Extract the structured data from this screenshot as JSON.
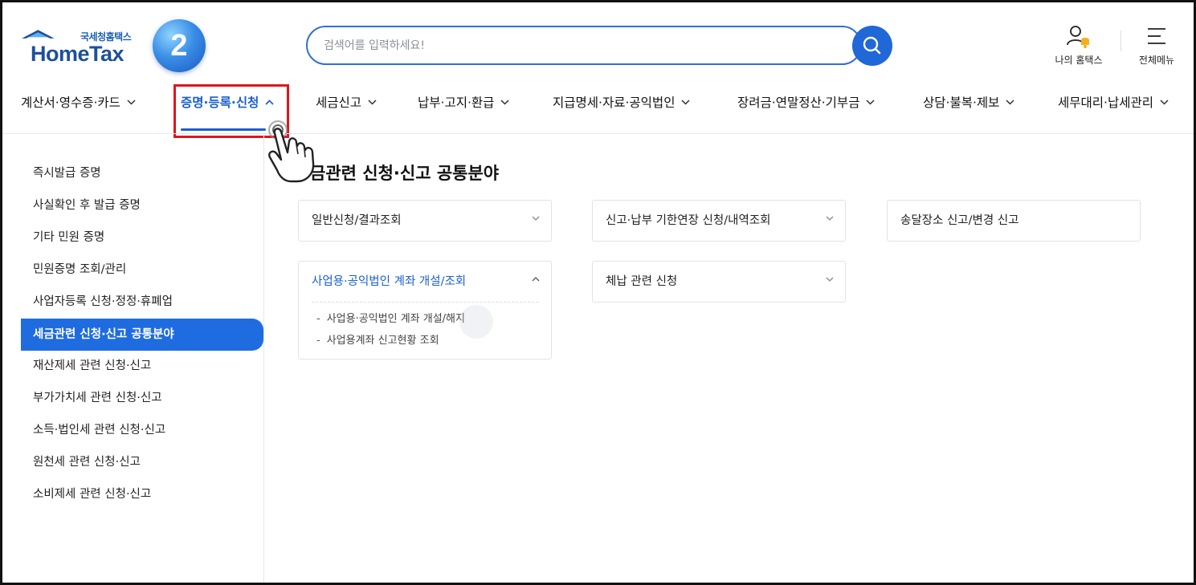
{
  "brand": {
    "logo_sub": "국세청홈택스",
    "logo_main": "HomeTax",
    "step_badge": "2"
  },
  "search": {
    "placeholder": "검색어를 입력하세요!"
  },
  "utilities": {
    "my_hometax": "나의 홈택스",
    "full_menu": "전체메뉴"
  },
  "nav": {
    "items": [
      {
        "label": "계산서·영수증·카드"
      },
      {
        "label": "증명·등록·신청"
      },
      {
        "label": "세금신고"
      },
      {
        "label": "납부·고지·환급"
      },
      {
        "label": "지급명세·자료·공익법인"
      },
      {
        "label": "장려금·연말정산·기부금"
      },
      {
        "label": "상담·불복·제보"
      },
      {
        "label": "세무대리·납세관리"
      }
    ]
  },
  "sidebar": {
    "items": [
      {
        "label": "즉시발급 증명"
      },
      {
        "label": "사실확인 후 발급 증명"
      },
      {
        "label": "기타 민원 증명"
      },
      {
        "label": "민원증명 조회/관리"
      },
      {
        "label": "사업자등록 신청·정정·휴폐업"
      },
      {
        "label": "세금관련 신청·신고 공통분야"
      },
      {
        "label": "재산제세 관련 신청·신고"
      },
      {
        "label": "부가가치세 관련 신청·신고"
      },
      {
        "label": "소득·법인세 관련 신청·신고"
      },
      {
        "label": "원천세 관련 신청·신고"
      },
      {
        "label": "소비제세 관련 신청·신고"
      }
    ]
  },
  "main": {
    "title": "금관련 신청·신고 공통분야",
    "cards": [
      {
        "label": "일반신청/결과조회"
      },
      {
        "label": "신고·납부 기한연장 신청/내역조회"
      },
      {
        "label": "송달장소 신고/변경 신고"
      },
      {
        "label": "사업용·공익법인 계좌 개설/조회",
        "subitems": [
          "사업용·공익법인 계좌 개설/해지",
          "사업용계좌 신고현황 조회"
        ]
      },
      {
        "label": "체납 관련 신청"
      }
    ]
  },
  "colors": {
    "accent": "#1b5fcf",
    "sidebar_active": "#1f6ce0",
    "highlight_box": "#e0141e",
    "bell": "#f2b01e"
  }
}
